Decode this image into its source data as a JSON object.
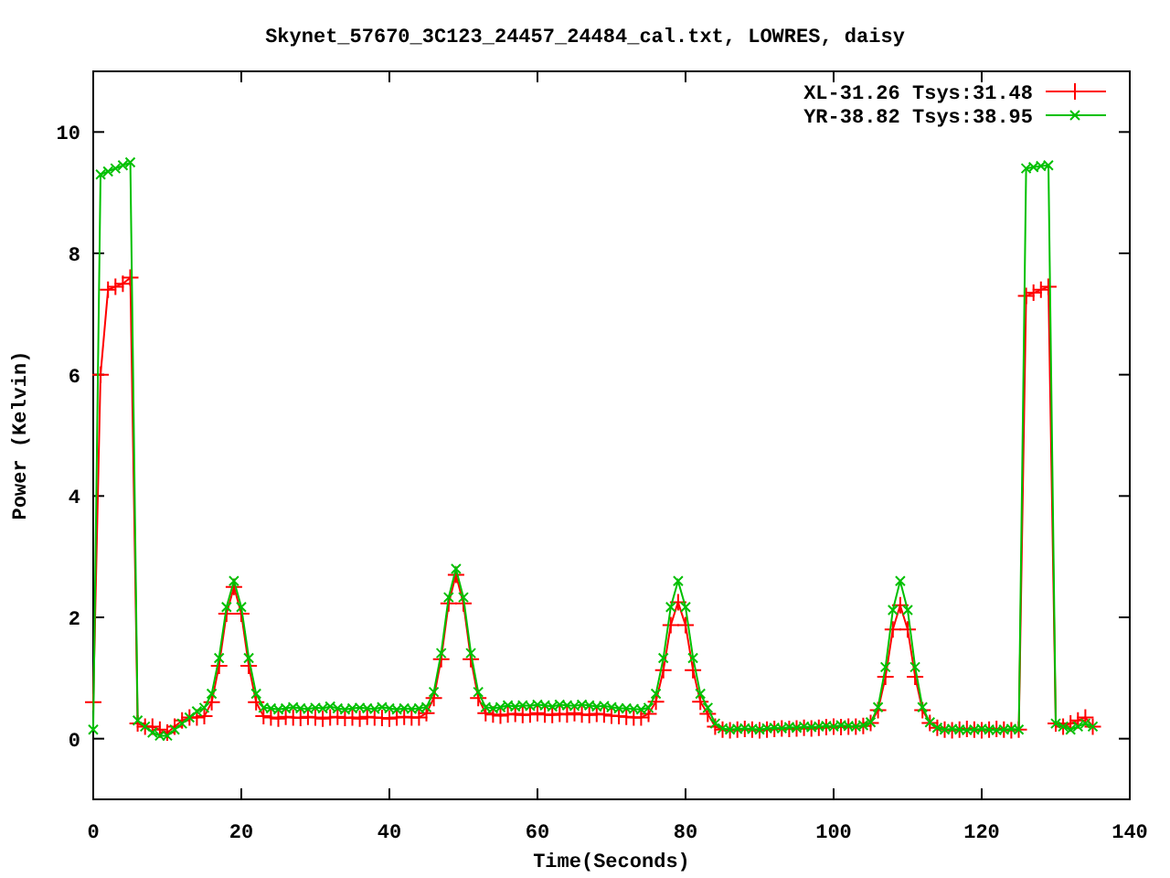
{
  "chart_data": {
    "type": "line",
    "legend": true,
    "title": "Skynet_57670_3C123_24457_24484_cal.txt, LOWRES, daisy",
    "xlabel": "Time(Seconds)",
    "ylabel": "Power (Kelvin)",
    "xlim": [
      0,
      140
    ],
    "ylim": [
      -1,
      11
    ],
    "xticks": [
      0,
      20,
      40,
      60,
      80,
      100,
      120,
      140
    ],
    "yticks": [
      0,
      2,
      4,
      6,
      8,
      10
    ],
    "x": [
      0,
      1,
      2,
      3,
      4,
      5,
      6,
      7,
      8,
      9,
      10,
      11,
      12,
      13,
      14,
      15,
      16,
      17,
      18,
      19,
      20,
      21,
      22,
      23,
      24,
      25,
      26,
      27,
      28,
      29,
      30,
      31,
      32,
      33,
      34,
      35,
      36,
      37,
      38,
      39,
      40,
      41,
      42,
      43,
      44,
      45,
      46,
      47,
      48,
      49,
      50,
      51,
      52,
      53,
      54,
      55,
      56,
      57,
      58,
      59,
      60,
      61,
      62,
      63,
      64,
      65,
      66,
      67,
      68,
      69,
      70,
      71,
      72,
      73,
      74,
      75,
      76,
      77,
      78,
      79,
      80,
      81,
      82,
      83,
      84,
      85,
      86,
      87,
      88,
      89,
      90,
      91,
      92,
      93,
      94,
      95,
      96,
      97,
      98,
      99,
      100,
      101,
      102,
      103,
      104,
      105,
      106,
      107,
      108,
      109,
      110,
      111,
      112,
      113,
      114,
      115,
      116,
      117,
      118,
      119,
      120,
      121,
      122,
      123,
      124,
      125,
      126,
      127,
      128,
      129,
      130,
      131,
      132,
      133,
      134,
      135
    ],
    "series": [
      {
        "name": "XL-31.26 Tsys:31.48",
        "color": "#ff0000",
        "marker": "plus",
        "values": [
          0.6,
          6.0,
          7.4,
          7.45,
          7.5,
          7.6,
          0.25,
          0.2,
          0.2,
          0.15,
          0.1,
          0.2,
          0.3,
          0.35,
          0.35,
          0.37,
          0.6,
          1.2,
          2.06,
          2.5,
          2.06,
          1.2,
          0.6,
          0.37,
          0.35,
          0.33,
          0.36,
          0.35,
          0.34,
          0.36,
          0.35,
          0.33,
          0.35,
          0.36,
          0.34,
          0.35,
          0.33,
          0.36,
          0.35,
          0.34,
          0.33,
          0.35,
          0.36,
          0.35,
          0.35,
          0.42,
          0.67,
          1.31,
          2.23,
          2.7,
          2.23,
          1.31,
          0.67,
          0.42,
          0.4,
          0.38,
          0.4,
          0.41,
          0.39,
          0.4,
          0.42,
          0.4,
          0.39,
          0.41,
          0.4,
          0.42,
          0.4,
          0.39,
          0.41,
          0.4,
          0.38,
          0.37,
          0.36,
          0.35,
          0.35,
          0.41,
          0.61,
          1.13,
          1.87,
          2.25,
          1.87,
          1.13,
          0.61,
          0.41,
          0.2,
          0.15,
          0.14,
          0.15,
          0.16,
          0.15,
          0.14,
          0.15,
          0.16,
          0.17,
          0.16,
          0.17,
          0.18,
          0.17,
          0.18,
          0.19,
          0.2,
          0.19,
          0.2,
          0.2,
          0.21,
          0.26,
          0.47,
          1.02,
          1.8,
          2.2,
          1.8,
          1.02,
          0.47,
          0.26,
          0.18,
          0.15,
          0.14,
          0.15,
          0.16,
          0.15,
          0.14,
          0.15,
          0.16,
          0.15,
          0.14,
          0.15,
          7.3,
          7.35,
          7.4,
          7.45,
          0.25,
          0.2,
          0.25,
          0.3,
          0.35,
          0.2
        ]
      },
      {
        "name": "YR-38.82 Tsys:38.95",
        "color": "#00c000",
        "marker": "cross",
        "values": [
          0.15,
          9.3,
          9.35,
          9.4,
          9.45,
          9.5,
          0.3,
          0.2,
          0.1,
          0.05,
          0.05,
          0.15,
          0.25,
          0.35,
          0.45,
          0.51,
          0.74,
          1.33,
          2.17,
          2.6,
          2.17,
          1.33,
          0.74,
          0.51,
          0.5,
          0.48,
          0.5,
          0.52,
          0.5,
          0.49,
          0.51,
          0.5,
          0.53,
          0.5,
          0.48,
          0.5,
          0.51,
          0.5,
          0.49,
          0.52,
          0.5,
          0.48,
          0.5,
          0.49,
          0.5,
          0.52,
          0.77,
          1.41,
          2.33,
          2.8,
          2.33,
          1.41,
          0.77,
          0.52,
          0.5,
          0.52,
          0.55,
          0.53,
          0.55,
          0.54,
          0.56,
          0.55,
          0.53,
          0.56,
          0.55,
          0.54,
          0.56,
          0.55,
          0.53,
          0.54,
          0.52,
          0.5,
          0.5,
          0.49,
          0.48,
          0.51,
          0.74,
          1.33,
          2.17,
          2.6,
          2.17,
          1.33,
          0.74,
          0.51,
          0.25,
          0.17,
          0.15,
          0.16,
          0.17,
          0.16,
          0.15,
          0.17,
          0.18,
          0.17,
          0.19,
          0.18,
          0.2,
          0.19,
          0.2,
          0.21,
          0.2,
          0.22,
          0.21,
          0.2,
          0.22,
          0.27,
          0.52,
          1.18,
          2.12,
          2.6,
          2.12,
          1.18,
          0.52,
          0.27,
          0.18,
          0.15,
          0.16,
          0.15,
          0.14,
          0.15,
          0.16,
          0.15,
          0.14,
          0.15,
          0.16,
          0.15,
          9.4,
          9.42,
          9.44,
          9.45,
          0.25,
          0.2,
          0.15,
          0.2,
          0.25,
          0.2
        ]
      }
    ]
  }
}
